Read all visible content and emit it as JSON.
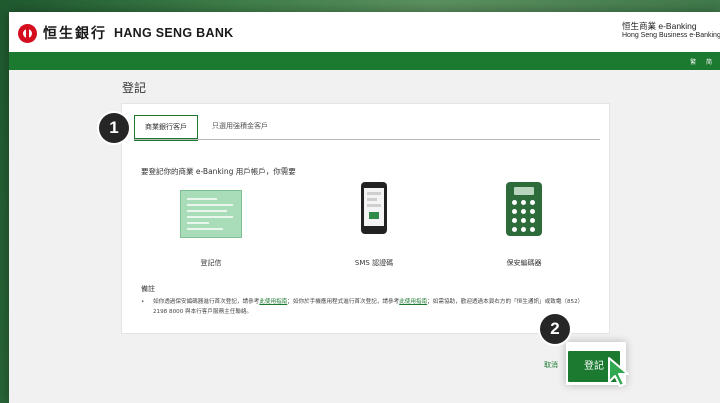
{
  "header": {
    "logo_cn": "恒生銀行",
    "logo_en": "HANG SENG BANK",
    "product_cn": "恒生商業 e-Banking",
    "product_en": "Hong Seng Business e-Banking",
    "language_links": "繁 简"
  },
  "page": {
    "title": "登記"
  },
  "tabs": [
    {
      "label": "商業銀行客戶",
      "active": true
    },
    {
      "label": "只選用強積金客戶",
      "active": false
    }
  ],
  "intro": "要登記你的商業 e-Banking 用戶帳戶，你需要",
  "options": [
    {
      "label": "登記信",
      "icon": "registration-letter-icon"
    },
    {
      "label": "SMS 認證碼",
      "icon": "mobile-phone-icon"
    },
    {
      "label": "保安編碼器",
      "icon": "security-token-icon"
    }
  ],
  "notes": {
    "title": "備註",
    "bullet": "•",
    "text_1": "如你透過保安編碼器進行首次登記，請參考",
    "link_1": "此使用指南",
    "text_2": "；如你於手機應用程式進行首次登記，請參考",
    "link_2": "此使用指南",
    "text_3": "；如需協助，歡迎透過本頁右方的「恒生通訊」或致電（852）2198 8000 與本行客戶服務主任聯絡。"
  },
  "actions": {
    "cancel": "取消",
    "register": "登記"
  },
  "badges": {
    "one": "1",
    "two": "2"
  },
  "colors": {
    "brand_green": "#1b7a30",
    "logo_red": "#d40e1e",
    "badge": "#262626"
  }
}
